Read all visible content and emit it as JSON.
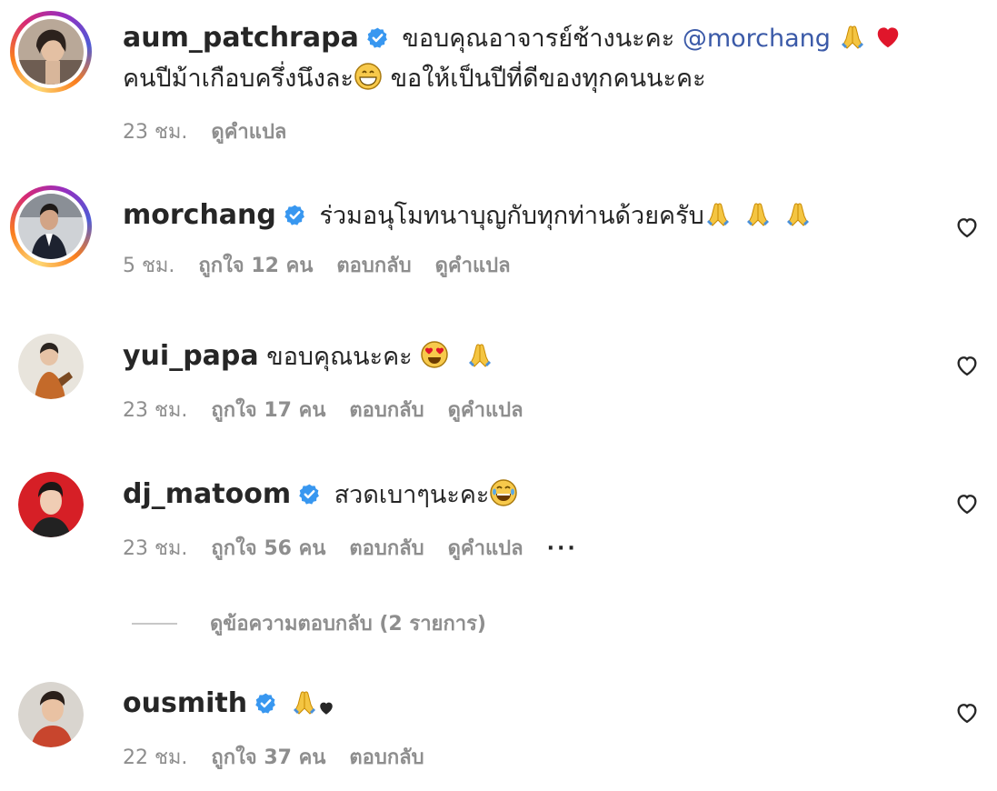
{
  "comments": [
    {
      "username": "aum_patchrapa",
      "verified": true,
      "text_line1": "ขอบคุณอาจารย์ช้างนะคะ",
      "mention": "@morchang",
      "text_line2": "คนปีม้าเกือบครึ่งนึงละ",
      "text_line2b": "ขอให้เป็นปีที่ดีของทุกคนนะคะ",
      "time": "23 ชม.",
      "translate": "ดูคำแปล"
    },
    {
      "username": "morchang",
      "verified": true,
      "text": "ร่วมอนุโมทนาบุญกับทุกท่านด้วยครับ",
      "time": "5 ชม.",
      "likes": "ถูกใจ 12 คน",
      "reply": "ตอบกลับ",
      "translate": "ดูคำแปล"
    },
    {
      "username": "yui_papa",
      "verified": false,
      "text": "ขอบคุณนะคะ",
      "time": "23 ชม.",
      "likes": "ถูกใจ 17 คน",
      "reply": "ตอบกลับ",
      "translate": "ดูคำแปล"
    },
    {
      "username": "dj_matoom",
      "verified": true,
      "text": "สวดเบาๆนะคะ",
      "time": "23 ชม.",
      "likes": "ถูกใจ 56 คน",
      "reply": "ตอบกลับ",
      "translate": "ดูคำแปล",
      "more": "···"
    },
    {
      "username": "ousmith",
      "verified": true,
      "text": "",
      "time": "22 ชม.",
      "likes": "ถูกใจ 37 คน",
      "reply": "ตอบกลับ"
    }
  ],
  "view_replies": "ดูข้อความตอบกลับ (2 รายการ)",
  "colors": {
    "verified_blue": "#3897f0",
    "mention": "#3b5aa8",
    "meta_gray": "#8e8e8e"
  },
  "icons": [
    "verified-badge-icon",
    "heart-outline-icon",
    "praying-hands-emoji",
    "red-heart-emoji",
    "grinning-emoji",
    "heart-eyes-emoji",
    "tears-of-joy-emoji",
    "black-heart-emoji"
  ]
}
